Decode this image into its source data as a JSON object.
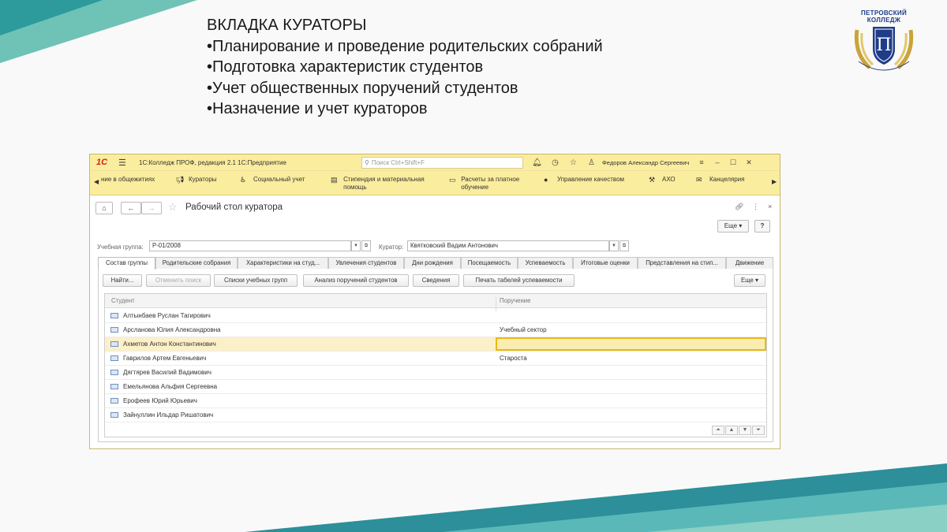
{
  "slide": {
    "heading": "ВКЛАДКА КУРАТОРЫ",
    "bullets": [
      "•Планирование и проведение родительских собраний",
      "•Подготовка характеристик студентов",
      "•Учет общественных поручений студентов",
      "•Назначение и учет кураторов"
    ],
    "logo_title_1": "ПЕТРОВСКИЙ",
    "logo_title_2": "КОЛЛЕДЖ",
    "logo_ribbon": "ПЕТРОВСКИЙ / LEARNING BY DOING"
  },
  "window": {
    "logo": "1С",
    "title": "1С:Колледж ПРОФ, редакция 2.1 1С:Предприятие",
    "search_placeholder": "Поиск Ctrl+Shift+F",
    "user": "Федоров Александр Сергеевич",
    "accent": "#fbed9e"
  },
  "sections": [
    {
      "label": "ние в общежитиях",
      "icon": ""
    },
    {
      "label": "Кураторы",
      "icon": "megaphone-icon"
    },
    {
      "label": "Социальный учет",
      "icon": "wheelchair-icon"
    },
    {
      "label": "Стипендия и материальная помощь",
      "icon": "document-icon"
    },
    {
      "label": "Расчеты за платное обучение",
      "icon": "card-icon"
    },
    {
      "label": "Управление качеством",
      "icon": "medal-icon"
    },
    {
      "label": "АХО",
      "icon": "hammer-icon"
    },
    {
      "label": "Канцелярия",
      "icon": "envelope-icon"
    }
  ],
  "form": {
    "title": "Рабочий стол куратора",
    "more_label": "Еще",
    "help_label": "?",
    "group_label": "Учебная группа:",
    "group_value": "Р-01/2008",
    "curator_label": "Куратор:",
    "curator_value": "Квятковский Вадим Антонович"
  },
  "tabs": [
    "Состав группы",
    "Родительские собрания",
    "Характеристики на студ...",
    "Увлечения студентов",
    "Дни рождения",
    "Посещаемость",
    "Успеваемость",
    "Итоговые оценки",
    "Представления на стип...",
    "Движение"
  ],
  "commands": [
    {
      "label": "Найти...",
      "enabled": true
    },
    {
      "label": "Отменить поиск",
      "enabled": false
    },
    {
      "label": "Списки учебных групп",
      "enabled": true
    },
    {
      "label": "Анализ поручений студентов",
      "enabled": true
    },
    {
      "label": "Сведения",
      "enabled": true
    },
    {
      "label": "Печать табелей успеваемости",
      "enabled": true
    }
  ],
  "commands_more": "Еще",
  "grid": {
    "columns": [
      "Студент",
      "Поручение"
    ],
    "rows": [
      {
        "student": "Алтынбаев Руслан Тагирович",
        "task": ""
      },
      {
        "student": "Арсланова Юлия Александровна",
        "task": "Учебный сектор"
      },
      {
        "student": "Ахметов Антон Константинович",
        "task": ""
      },
      {
        "student": "Гаврилов Артем Евгеньевич",
        "task": "Староста"
      },
      {
        "student": "Дягтярев Василий Вадимович",
        "task": ""
      },
      {
        "student": "Емельянова Альфия Сергеевна",
        "task": ""
      },
      {
        "student": "Ерофеев Юрий Юрьевич",
        "task": ""
      },
      {
        "student": "Зайнуллин Ильдар Ришатович",
        "task": ""
      }
    ],
    "selected_row": 2
  }
}
